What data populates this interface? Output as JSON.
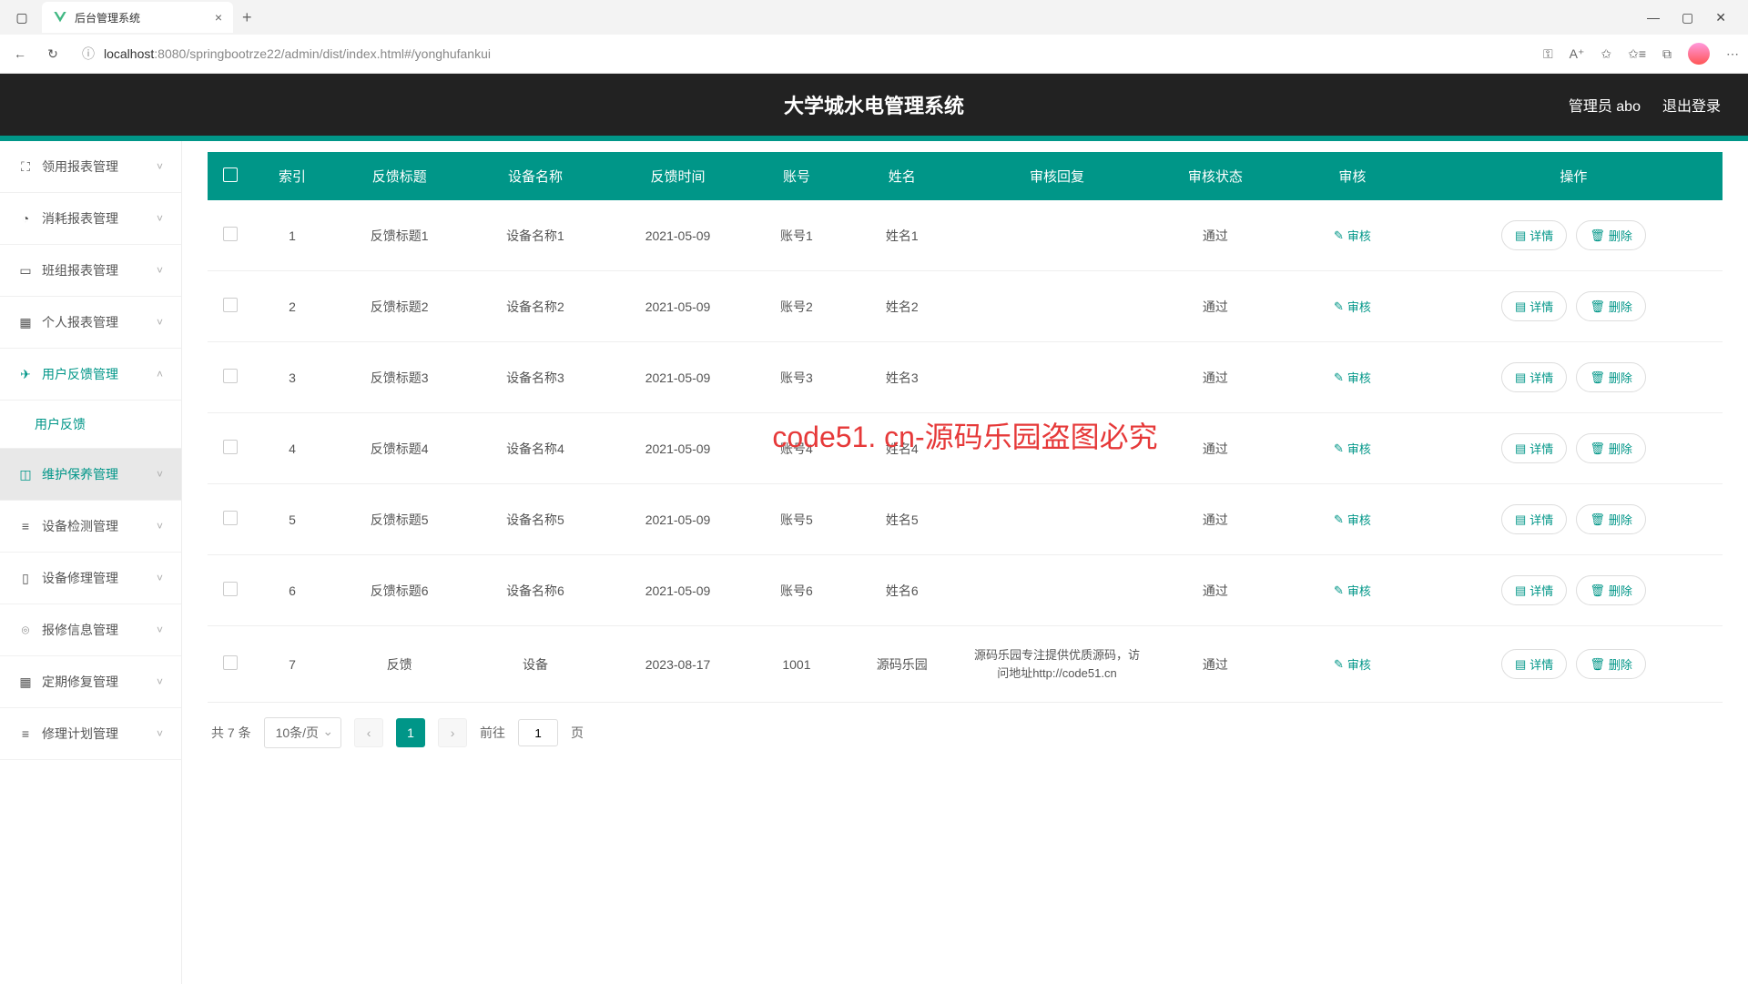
{
  "browser": {
    "tab_title": "后台管理系统",
    "url_host": "localhost",
    "url_port": ":8080",
    "url_path": "/springbootrze22/admin/dist/index.html#/yonghufankui"
  },
  "header": {
    "app_title": "大学城水电管理系统",
    "admin_label": "管理员 abo",
    "logout_label": "退出登录"
  },
  "sidebar": {
    "items": [
      {
        "icon": "⛶",
        "label": "领用报表管理",
        "expanded": false
      },
      {
        "icon": "◔",
        "label": "消耗报表管理",
        "expanded": false
      },
      {
        "icon": "▭",
        "label": "班组报表管理",
        "expanded": false
      },
      {
        "icon": "▦",
        "label": "个人报表管理",
        "expanded": false
      },
      {
        "icon": "✈",
        "label": "用户反馈管理",
        "expanded": true,
        "sub": "用户反馈"
      },
      {
        "icon": "◫",
        "label": "维护保养管理",
        "expanded": false,
        "hovered": true
      },
      {
        "icon": "≡",
        "label": "设备检测管理",
        "expanded": false
      },
      {
        "icon": "▯",
        "label": "设备修理管理",
        "expanded": false
      },
      {
        "icon": "⌾",
        "label": "报修信息管理",
        "expanded": false
      },
      {
        "icon": "▦",
        "label": "定期修复管理",
        "expanded": false
      },
      {
        "icon": "≡",
        "label": "修理计划管理",
        "expanded": false
      }
    ]
  },
  "table": {
    "columns": [
      "索引",
      "反馈标题",
      "设备名称",
      "反馈时间",
      "账号",
      "姓名",
      "审核回复",
      "审核状态",
      "审核",
      "操作"
    ],
    "audit_btn": "审核",
    "detail_btn": "详情",
    "delete_btn": "删除",
    "rows": [
      {
        "idx": "1",
        "title": "反馈标题1",
        "device": "设备名称1",
        "time": "2021-05-09",
        "account": "账号1",
        "name": "姓名1",
        "reply": "",
        "status": "通过"
      },
      {
        "idx": "2",
        "title": "反馈标题2",
        "device": "设备名称2",
        "time": "2021-05-09",
        "account": "账号2",
        "name": "姓名2",
        "reply": "",
        "status": "通过"
      },
      {
        "idx": "3",
        "title": "反馈标题3",
        "device": "设备名称3",
        "time": "2021-05-09",
        "account": "账号3",
        "name": "姓名3",
        "reply": "",
        "status": "通过"
      },
      {
        "idx": "4",
        "title": "反馈标题4",
        "device": "设备名称4",
        "time": "2021-05-09",
        "account": "账号4",
        "name": "姓名4",
        "reply": "",
        "status": "通过"
      },
      {
        "idx": "5",
        "title": "反馈标题5",
        "device": "设备名称5",
        "time": "2021-05-09",
        "account": "账号5",
        "name": "姓名5",
        "reply": "",
        "status": "通过"
      },
      {
        "idx": "6",
        "title": "反馈标题6",
        "device": "设备名称6",
        "time": "2021-05-09",
        "account": "账号6",
        "name": "姓名6",
        "reply": "",
        "status": "通过"
      },
      {
        "idx": "7",
        "title": "反馈",
        "device": "设备",
        "time": "2023-08-17",
        "account": "1001",
        "name": "源码乐园",
        "reply": "源码乐园专注提供优质源码，访问地址http://code51.cn",
        "status": "通过"
      }
    ]
  },
  "pagination": {
    "total": "共 7 条",
    "page_size": "10条/页",
    "current": "1",
    "goto_prefix": "前往",
    "goto_value": "1",
    "goto_suffix": "页"
  },
  "watermark": {
    "main": "code51. cn-源码乐园盗图必究",
    "faded": "code51.cn"
  }
}
